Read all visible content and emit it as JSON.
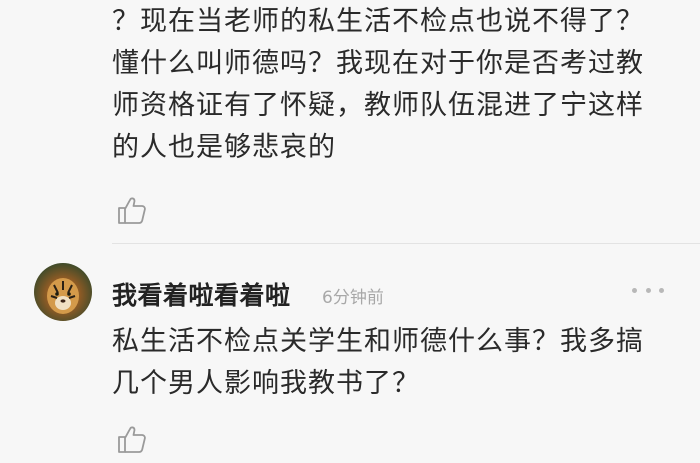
{
  "comments": [
    {
      "text": "？现在当老师的私生活不检点也说不得了？\n懂什么叫师德吗？我现在对于你是否考过教\n师资格证有了怀疑，教师队伍混进了宁这样\n的人也是够悲哀的",
      "like_icon": "thumbs-up-icon"
    },
    {
      "username": "我看着啦看着啦",
      "timestamp": "6分钟前",
      "avatar": "tiger-avatar",
      "more_icon": "more-dots-icon",
      "text": "私生活不检点关学生和师德什么事？我多搞\n几个男人影响我教书了？",
      "like_icon": "thumbs-up-icon"
    }
  ]
}
